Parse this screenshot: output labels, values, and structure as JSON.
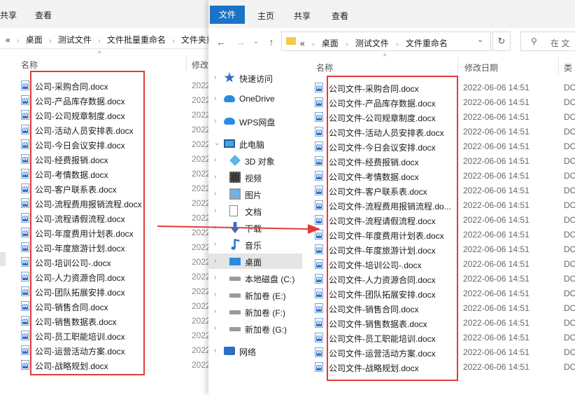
{
  "back_window": {
    "ribbon_tabs": [
      "共享",
      "查看"
    ],
    "breadcrumb": [
      "«",
      "桌面",
      "测试文件",
      "文件批量重命名",
      "文件夹重"
    ],
    "col_name": "名称",
    "col_date": "修改",
    "sort_arrow": "^",
    "files": [
      {
        "name": "公司-采购合同.docx",
        "date": "2022"
      },
      {
        "name": "公司-产品库存数据.docx",
        "date": "2022"
      },
      {
        "name": "公司-公司规章制度.docx",
        "date": "2022"
      },
      {
        "name": "公司-活动人员安排表.docx",
        "date": "2022"
      },
      {
        "name": "公司-今日会议安排.docx",
        "date": "2022"
      },
      {
        "name": "公司-经费报销.docx",
        "date": "2022"
      },
      {
        "name": "公司-考情数据.docx",
        "date": "2022"
      },
      {
        "name": "公司-客户联系表.docx",
        "date": "2022"
      },
      {
        "name": "公司-流程费用报销流程.docx",
        "date": "2022"
      },
      {
        "name": "公司-流程请假流程.docx",
        "date": "2022"
      },
      {
        "name": "公司-年度费用计划表.docx",
        "date": "2022"
      },
      {
        "name": "公司-年度旅游计划.docx",
        "date": "2022"
      },
      {
        "name": "公司-培训公司-.docx",
        "date": "2022"
      },
      {
        "name": "公司-人力资源合同.docx",
        "date": "2022"
      },
      {
        "name": "公司-团队拓展安排.docx",
        "date": "2022"
      },
      {
        "name": "公司-销售合同.docx",
        "date": "2022"
      },
      {
        "name": "公司-销售数据表.docx",
        "date": "2022"
      },
      {
        "name": "公司-员工职能培训.docx",
        "date": "2022"
      },
      {
        "name": "公司-运营活动方案.docx",
        "date": "2022"
      },
      {
        "name": "公司-战略规划.docx",
        "date": "2022"
      }
    ]
  },
  "front_window": {
    "ribbon_tabs": {
      "file": "文件",
      "home": "主页",
      "share": "共享",
      "view": "查看"
    },
    "nav_buttons": {
      "back": "←",
      "forward": "→",
      "up": "↑",
      "recent": "⌄"
    },
    "breadcrumb": [
      "«",
      "桌面",
      "测试文件",
      "文件重命名"
    ],
    "address_dropdown": "⌄",
    "refresh": "↻",
    "search_placeholder": "在 文",
    "col_name": "名称",
    "col_date": "修改日期",
    "col_type": "类",
    "sort_arrow": "^",
    "nav_pane": [
      {
        "label": "快速访问",
        "icon": "star-icon",
        "chev": "›"
      },
      {
        "label": "OneDrive",
        "icon": "cloud-icon",
        "chev": "›"
      },
      {
        "label": "WPS网盘",
        "icon": "cloud-icon",
        "chev": "›"
      },
      {
        "label": "此电脑",
        "icon": "computer-icon",
        "chev": "⌄"
      },
      {
        "label": "3D 对象",
        "icon": "cube-icon",
        "chev": "›"
      },
      {
        "label": "视频",
        "icon": "video-icon",
        "chev": "›"
      },
      {
        "label": "图片",
        "icon": "picture-icon",
        "chev": "›"
      },
      {
        "label": "文档",
        "icon": "document-icon",
        "chev": "›"
      },
      {
        "label": "下载",
        "icon": "download-icon",
        "chev": "›"
      },
      {
        "label": "音乐",
        "icon": "music-icon",
        "chev": "›"
      },
      {
        "label": "桌面",
        "icon": "desktop-icon",
        "chev": "›",
        "selected": true
      },
      {
        "label": "本地磁盘 (C:)",
        "icon": "drive-icon",
        "chev": "›"
      },
      {
        "label": "新加卷 (E:)",
        "icon": "drive-icon",
        "chev": "›"
      },
      {
        "label": "新加卷 (F:)",
        "icon": "drive-icon",
        "chev": "›"
      },
      {
        "label": "新加卷 (G:)",
        "icon": "drive-icon",
        "chev": "›"
      },
      {
        "label": "网络",
        "icon": "network-icon",
        "chev": "›"
      }
    ],
    "files": [
      {
        "name": "公司文件-采购合同.docx",
        "date": "2022-06-06 14:51",
        "type": "DO"
      },
      {
        "name": "公司文件-产品库存数据.docx",
        "date": "2022-06-06 14:51",
        "type": "DO"
      },
      {
        "name": "公司文件-公司规章制度.docx",
        "date": "2022-06-06 14:51",
        "type": "DO"
      },
      {
        "name": "公司文件-活动人员安排表.docx",
        "date": "2022-06-06 14:51",
        "type": "DO"
      },
      {
        "name": "公司文件-今日会议安排.docx",
        "date": "2022-06-06 14:51",
        "type": "DO"
      },
      {
        "name": "公司文件-经费报销.docx",
        "date": "2022-06-06 14:51",
        "type": "DO"
      },
      {
        "name": "公司文件-考情数据.docx",
        "date": "2022-06-06 14:51",
        "type": "DO"
      },
      {
        "name": "公司文件-客户联系表.docx",
        "date": "2022-06-06 14:51",
        "type": "DO"
      },
      {
        "name": "公司文件-流程费用报销流程.do...",
        "date": "2022-06-06 14:51",
        "type": "DO"
      },
      {
        "name": "公司文件-流程请假流程.docx",
        "date": "2022-06-06 14:51",
        "type": "DO"
      },
      {
        "name": "公司文件-年度费用计划表.docx",
        "date": "2022-06-06 14:51",
        "type": "DO"
      },
      {
        "name": "公司文件-年度旅游计划.docx",
        "date": "2022-06-06 14:51",
        "type": "DO"
      },
      {
        "name": "公司文件-培训公司-.docx",
        "date": "2022-06-06 14:51",
        "type": "DO"
      },
      {
        "name": "公司文件-人力资源合同.docx",
        "date": "2022-06-06 14:51",
        "type": "DO"
      },
      {
        "name": "公司文件-团队拓展安排.docx",
        "date": "2022-06-06 14:51",
        "type": "DO"
      },
      {
        "name": "公司文件-销售合同.docx",
        "date": "2022-06-06 14:51",
        "type": "DO"
      },
      {
        "name": "公司文件-销售数据表.docx",
        "date": "2022-06-06 14:51",
        "type": "DO"
      },
      {
        "name": "公司文件-员工职能培训.docx",
        "date": "2022-06-06 14:51",
        "type": "DO"
      },
      {
        "name": "公司文件-运营活动方案.docx",
        "date": "2022-06-06 14:51",
        "type": "DO"
      },
      {
        "name": "公司文件-战略规划.docx",
        "date": "2022-06-06 14:51",
        "type": "DO"
      }
    ]
  },
  "colors": {
    "accent": "#1a73c8",
    "annotation": "#e03b3b",
    "selected": "#e5e5e5"
  }
}
